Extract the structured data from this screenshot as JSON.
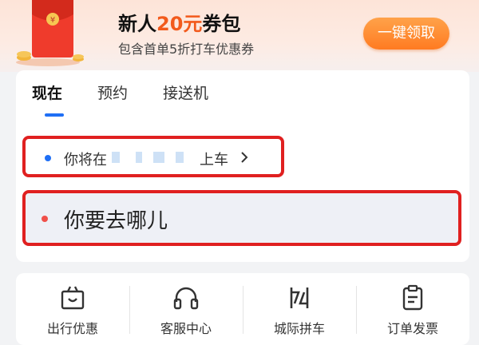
{
  "promo": {
    "title_prefix": "新人",
    "title_amount": "20元",
    "title_suffix": "券包",
    "subtitle": "包含首单5折打车优惠券",
    "button_label": "一键领取",
    "packet_symbol": "¥",
    "icon": "red-packet-icon"
  },
  "tabs": [
    {
      "label": "现在",
      "active": true
    },
    {
      "label": "预约",
      "active": false
    },
    {
      "label": "接送机",
      "active": false
    }
  ],
  "pickup": {
    "prefix": "你将在",
    "suffix": "上车",
    "icon": "chevron-right-icon"
  },
  "destination": {
    "placeholder": "你要去哪儿"
  },
  "services": [
    {
      "label": "出行优惠",
      "icon": "gift-icon"
    },
    {
      "label": "客服中心",
      "icon": "headset-icon"
    },
    {
      "label": "城际拼车",
      "icon": "intercity-icon"
    },
    {
      "label": "订单发票",
      "icon": "invoice-icon"
    }
  ],
  "colors": {
    "accent_blue": "#1f6ff5",
    "promo_orange": "#f25a1c",
    "highlight_red": "#e02020"
  }
}
